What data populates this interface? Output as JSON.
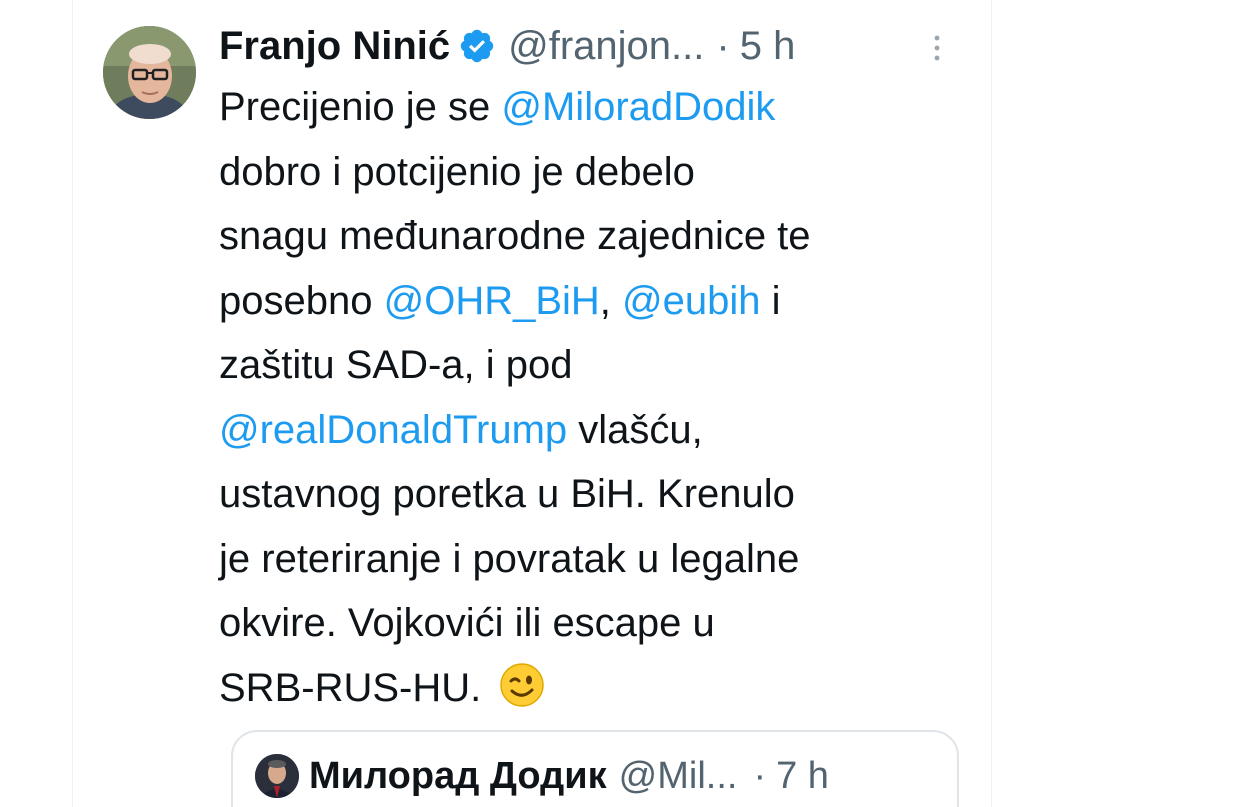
{
  "tweet": {
    "author_name": "Franjo Ninić",
    "handle": "@franjon...",
    "separator": "·",
    "time": "5 h",
    "verified_color": "#1d9bf0",
    "lines": [
      [
        {
          "text": "Precijenio je se "
        },
        {
          "text": "@MiloradDodik",
          "mention": true
        }
      ],
      [
        {
          "text": "dobro i potcijenio je debelo"
        }
      ],
      [
        {
          "text": "snagu međunarodne zajednice te"
        }
      ],
      [
        {
          "text": "posebno "
        },
        {
          "text": "@OHR_BiH",
          "mention": true
        },
        {
          "text": ", "
        },
        {
          "text": "@eubih",
          "mention": true
        },
        {
          "text": " i"
        }
      ],
      [
        {
          "text": "zaštitu SAD-a, i pod"
        }
      ],
      [
        {
          "text": "@realDonaldTrump",
          "mention": true
        },
        {
          "text": " vlašću,"
        }
      ],
      [
        {
          "text": "ustavnog poretka u BiH. Krenulo"
        }
      ],
      [
        {
          "text": "je reteriranje i povratak u legalne"
        }
      ],
      [
        {
          "text": "okvire. Vojkovići ili escape u"
        }
      ],
      [
        {
          "text": "SRB-RUS-HU. "
        },
        {
          "emoji": "winking-face-icon"
        }
      ]
    ]
  },
  "quoted_tweet": {
    "author_name": "Милорад Додик",
    "handle": "@Mil...",
    "separator": "·",
    "time": "7 h"
  },
  "colors": {
    "mention": "#1d9bf0",
    "secondary_text": "#536471",
    "primary_text": "#0f1419"
  }
}
